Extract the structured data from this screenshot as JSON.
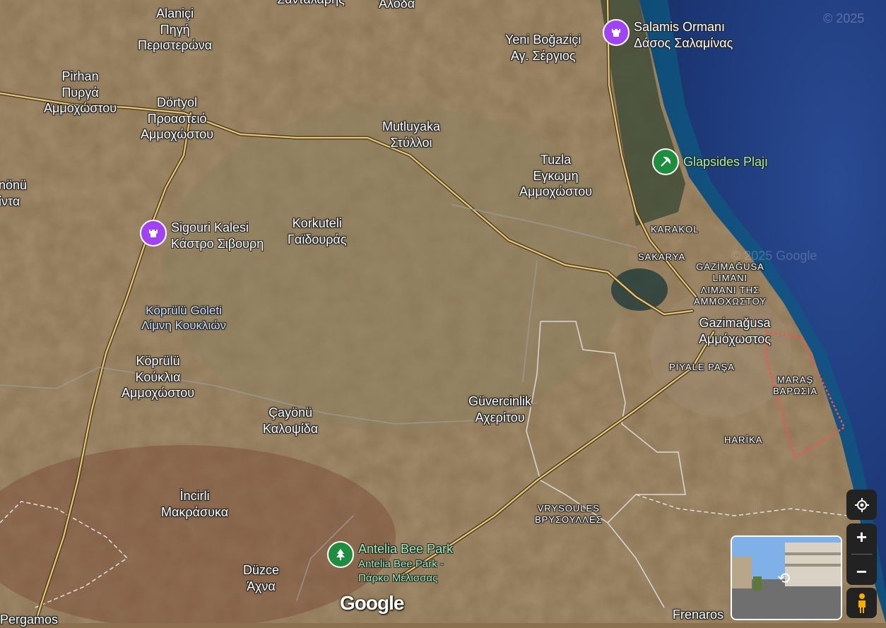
{
  "map": {
    "colors": {
      "land": "#8b7050",
      "sea": "#1f3a78",
      "coast": "#0d4f7a",
      "road": "#e8c878"
    }
  },
  "labels": {
    "top_cut_1": "Σανταλάρης",
    "top_cut_2": "Άλοδα",
    "alanici": [
      "Alaniçi",
      "Πηγή",
      "Περιστερώνα"
    ],
    "pirhan": [
      "Pirhan",
      "Πυργά",
      "Αμμοχώστου"
    ],
    "dortyol": [
      "Dörtyol",
      "Προαστειό",
      "Αμμοχώστου"
    ],
    "inonu": [
      "nönü",
      "ίντα"
    ],
    "yeni_bogazici": [
      "Yeni Boğaziçi",
      "Αγ. Σέργιος"
    ],
    "mutluyaka": [
      "Mutluyaka",
      "Στύλλοι"
    ],
    "tuzla": [
      "Tuzla",
      "Εγκωμη",
      "Αμμοχώστου"
    ],
    "korkuteli": [
      "Korkuteli",
      "Γαϊδουράς"
    ],
    "koprulu_goleti": [
      "Köprülü Göleti",
      "Λίμνη Κουκλιών"
    ],
    "koprulu": [
      "Köprülü",
      "Κούκλια",
      "Αμμοχώστου"
    ],
    "cayonu": [
      "Çayönü",
      "Καλοψίδα"
    ],
    "guvercinlik": [
      "Güvercinlik",
      "Αχερίτου"
    ],
    "incirli": [
      "İncirli",
      "Μακράσυκα"
    ],
    "duzce": [
      "Düzce",
      "Άχνα"
    ],
    "pergamos": "Pergamos",
    "frenaros": "Frenaros",
    "karakol": "KARAKOL",
    "sakarya": "SAKARYA",
    "gazimagusa_limani": [
      "GAZİMAĞUSA",
      "LİMANI",
      "ΛΙΜΑΝΙ ΤΗΣ",
      "ΑΜΜΟΧΩΣΤΟΥ"
    ],
    "gazimagusa": [
      "Gazimağusa",
      "Αμμόχωστος"
    ],
    "piyale_pasa": "PİYALE PAŞA",
    "maras": [
      "MARAŞ",
      "ΒΑΡΩΣΙΑ"
    ],
    "harika": "HARİKA",
    "vrysoules": [
      "VRYSOULES",
      "ΒΡΥΣΟΥΛΛΕΣ"
    ]
  },
  "pois": {
    "salamis": {
      "name": "Salamis Ormanı",
      "sub": "Δάσος Σαλαμίνας",
      "icon": "castle-icon",
      "color": "#a142f4"
    },
    "sigouri": {
      "name": "Sigouri Kalesi",
      "sub": "Κάστρο Σιβουρη",
      "icon": "castle-icon",
      "color": "#a142f4"
    },
    "glapsides": {
      "name": "Glapsides Plajı",
      "icon": "beach-icon",
      "color": "#1e8e3e"
    },
    "antelia": {
      "name": "Antelia Bee Park",
      "sub": "Antelia Bee Park -",
      "sub2": "Πάρκο Μέλισσας",
      "icon": "tree-icon",
      "color": "#1e8e3e"
    }
  },
  "watermarks": {
    "copyright_top": "© 2025",
    "copyright_mid": "© 2025 Google"
  },
  "controls": {
    "zoom_in": "+",
    "zoom_out": "−",
    "logo": "Google"
  }
}
